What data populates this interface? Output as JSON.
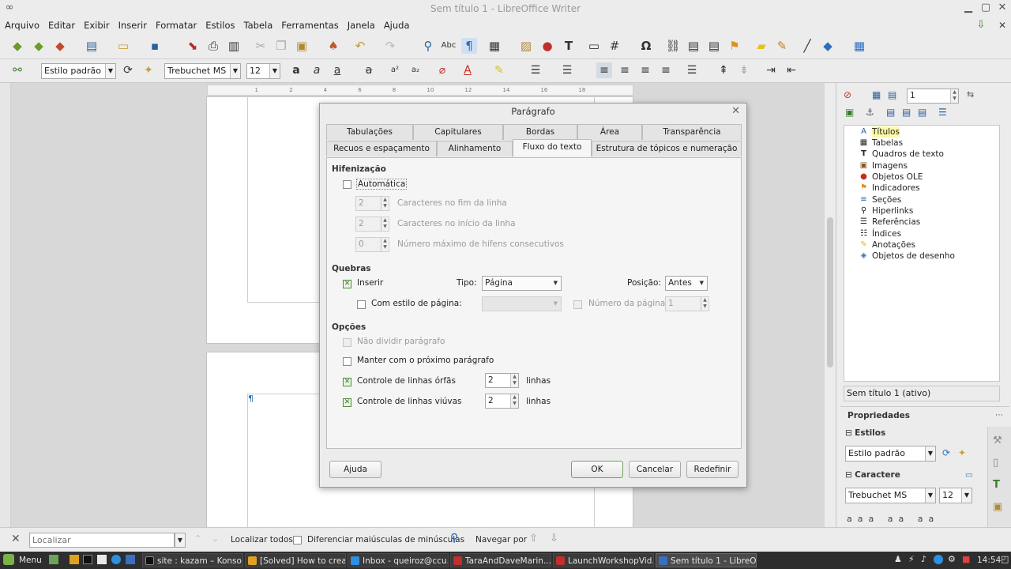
{
  "window": {
    "title": "Sem título 1 - LibreOffice Writer"
  },
  "menu": [
    "Arquivo",
    "Editar",
    "Exibir",
    "Inserir",
    "Formatar",
    "Estilos",
    "Tabela",
    "Ferramentas",
    "Janela",
    "Ajuda"
  ],
  "toolbar2": {
    "style": "Estilo padrão",
    "font": "Trebuchet MS",
    "size": "12"
  },
  "ruler": {
    "marks": [
      "1",
      "2",
      "4",
      "6",
      "8",
      "10",
      "12",
      "14",
      "16",
      "18"
    ]
  },
  "document": {
    "pilcrow": "¶"
  },
  "dialog": {
    "title": "Parágrafo",
    "tabs_row1": [
      "Tabulações",
      "Capitulares",
      "Bordas",
      "Área",
      "Transparência"
    ],
    "tabs_row2": [
      "Recuos e espaçamento",
      "Alinhamento",
      "Fluxo do texto",
      "Estrutura de tópicos e numeração"
    ],
    "hyphenation": {
      "heading": "Hifenização",
      "auto_label": "Automática",
      "chars_end_value": "2",
      "chars_end_label": "Caracteres no fim da linha",
      "chars_start_value": "2",
      "chars_start_label": "Caracteres no início da linha",
      "max_hyphens_value": "0",
      "max_hyphens_label": "Número máximo de hífens consecutivos"
    },
    "breaks": {
      "heading": "Quebras",
      "insert_label": "Inserir",
      "type_label": "Tipo:",
      "type_value": "Página",
      "position_label": "Posição:",
      "position_value": "Antes",
      "page_style_label": "Com estilo de página:",
      "page_number_label": "Número da página:",
      "page_number_value": "1"
    },
    "options": {
      "heading": "Opções",
      "no_split_label": "Não dividir parágrafo",
      "keep_next_label": "Manter com o próximo parágrafo",
      "orphan_label": "Controle de linhas órfãs",
      "orphan_value": "2",
      "widow_label": "Controle de linhas viúvas",
      "widow_value": "2",
      "lines_label": "linhas"
    },
    "buttons": {
      "help": "Ajuda",
      "ok": "OK",
      "cancel": "Cancelar",
      "reset": "Redefinir"
    }
  },
  "navigator": {
    "page_value": "1",
    "items": [
      {
        "label": "Títulos",
        "icon": "A"
      },
      {
        "label": "Tabelas",
        "icon": "▦"
      },
      {
        "label": "Quadros de texto",
        "icon": "T"
      },
      {
        "label": "Imagens",
        "icon": "▣"
      },
      {
        "label": "Objetos OLE",
        "icon": "●"
      },
      {
        "label": "Indicadores",
        "icon": "⚑"
      },
      {
        "label": "Seções",
        "icon": "≡"
      },
      {
        "label": "Hiperlinks",
        "icon": "⚲"
      },
      {
        "label": "Referências",
        "icon": "☰"
      },
      {
        "label": "Índices",
        "icon": "☷"
      },
      {
        "label": "Anotações",
        "icon": "✎"
      },
      {
        "label": "Objetos de desenho",
        "icon": "◈"
      }
    ],
    "doc_status": "Sem título 1 (ativo)"
  },
  "properties": {
    "title": "Propriedades",
    "styles_heading": "Estilos",
    "style_value": "Estilo padrão",
    "char_heading": "Caractere",
    "font_value": "Trebuchet MS",
    "size_value": "12"
  },
  "findbar": {
    "placeholder": "Localizar",
    "find_all": "Localizar todos",
    "match_case": "Diferenciar maiúsculas de minúsculas",
    "navigate_by": "Navegar por"
  },
  "taskbar": {
    "menu": "Menu",
    "tasks": [
      "site : kazam – Konsole",
      "[Solved] How to crea...",
      "Inbox - queiroz@ccu...",
      "TaraAndDaveMarin...",
      "LaunchWorkshopVid...",
      "Sem título 1 - LibreO..."
    ],
    "clock": "14:54"
  },
  "colors": {
    "accent_green": "#4f8a3c",
    "selected_highlight": "#fff9a8",
    "taskbar": "#2e2e2e"
  }
}
